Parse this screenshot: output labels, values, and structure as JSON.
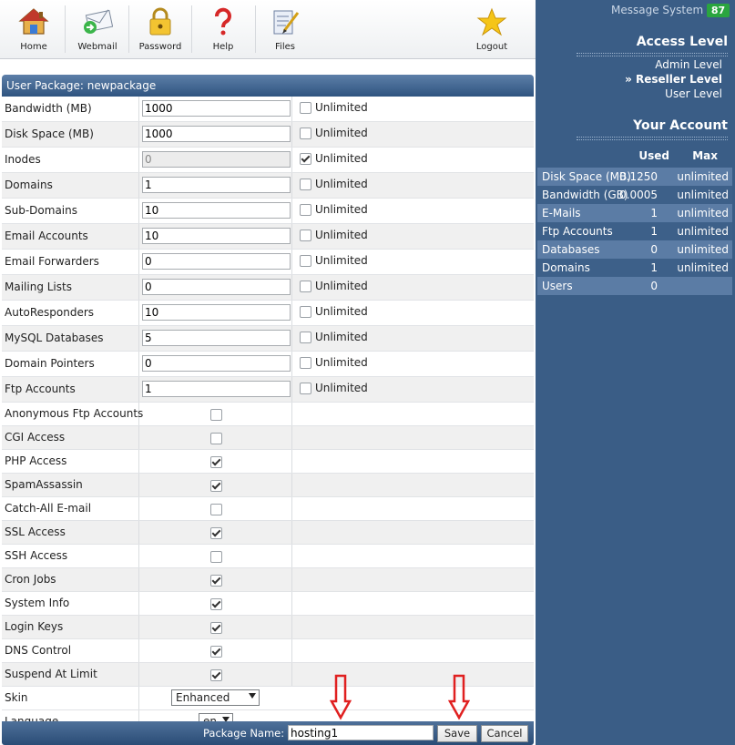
{
  "toolbar": {
    "items": [
      {
        "label": "Home",
        "icon": "home-icon"
      },
      {
        "label": "Webmail",
        "icon": "webmail-icon"
      },
      {
        "label": "Password",
        "icon": "lock-icon"
      },
      {
        "label": "Help",
        "icon": "question-icon"
      },
      {
        "label": "Files",
        "icon": "files-icon"
      },
      {
        "label": "Logout",
        "icon": "star-icon"
      }
    ]
  },
  "package": {
    "header": "User Package: newpackage",
    "unlimited_label": "Unlimited",
    "limits": [
      {
        "label": "Bandwidth (MB)",
        "value": "1000",
        "unlimited": false,
        "disabled": false
      },
      {
        "label": "Disk Space (MB)",
        "value": "1000",
        "unlimited": false,
        "disabled": false
      },
      {
        "label": "Inodes",
        "value": "0",
        "unlimited": true,
        "disabled": true
      },
      {
        "label": "Domains",
        "value": "1",
        "unlimited": false,
        "disabled": false
      },
      {
        "label": "Sub-Domains",
        "value": "10",
        "unlimited": false,
        "disabled": false
      },
      {
        "label": "Email Accounts",
        "value": "10",
        "unlimited": false,
        "disabled": false
      },
      {
        "label": "Email Forwarders",
        "value": "0",
        "unlimited": false,
        "disabled": false
      },
      {
        "label": "Mailing Lists",
        "value": "0",
        "unlimited": false,
        "disabled": false
      },
      {
        "label": "AutoResponders",
        "value": "10",
        "unlimited": false,
        "disabled": false
      },
      {
        "label": "MySQL Databases",
        "value": "5",
        "unlimited": false,
        "disabled": false
      },
      {
        "label": "Domain Pointers",
        "value": "0",
        "unlimited": false,
        "disabled": false
      },
      {
        "label": "Ftp Accounts",
        "value": "1",
        "unlimited": false,
        "disabled": false
      }
    ],
    "features": [
      {
        "label": "Anonymous Ftp Accounts",
        "checked": false
      },
      {
        "label": "CGI Access",
        "checked": false
      },
      {
        "label": "PHP Access",
        "checked": true
      },
      {
        "label": "SpamAssassin",
        "checked": true
      },
      {
        "label": "Catch-All E-mail",
        "checked": false
      },
      {
        "label": "SSL Access",
        "checked": true
      },
      {
        "label": "SSH Access",
        "checked": false
      },
      {
        "label": "Cron Jobs",
        "checked": true
      },
      {
        "label": "System Info",
        "checked": true
      },
      {
        "label": "Login Keys",
        "checked": true
      },
      {
        "label": "DNS Control",
        "checked": true
      },
      {
        "label": "Suspend At Limit",
        "checked": true
      }
    ],
    "skin": {
      "label": "Skin",
      "value": "Enhanced"
    },
    "language": {
      "label": "Language",
      "value": "en"
    },
    "footer": {
      "name_label": "Package Name:",
      "name_value": "hosting1",
      "save_label": "Save",
      "cancel_label": "Cancel"
    }
  },
  "sidebar": {
    "message_system": "Message System",
    "message_count": "87",
    "access_level_title": "Access Level",
    "levels": [
      {
        "label": "Admin Level",
        "active": false
      },
      {
        "label": "» Reseller Level",
        "active": true
      },
      {
        "label": "User Level",
        "active": false
      }
    ],
    "account_title": "Your Account",
    "col_used": "Used",
    "col_max": "Max",
    "account_rows": [
      {
        "name": "Disk Space (MB)",
        "used": "0.1250",
        "max": "unlimited"
      },
      {
        "name": "Bandwidth (GB)",
        "used": "0.0005",
        "max": "unlimited"
      },
      {
        "name": "E-Mails",
        "used": "1",
        "max": "unlimited"
      },
      {
        "name": "Ftp Accounts",
        "used": "1",
        "max": "unlimited"
      },
      {
        "name": "Databases",
        "used": "0",
        "max": "unlimited"
      },
      {
        "name": "Domains",
        "used": "1",
        "max": "unlimited"
      },
      {
        "name": "Users",
        "used": "0",
        "max": ""
      }
    ]
  },
  "colors": {
    "sidebar_bg": "#3a5d86",
    "header_bar": "#2f5480",
    "badge_green": "#2aa53f",
    "arrow_red": "#e02020"
  }
}
